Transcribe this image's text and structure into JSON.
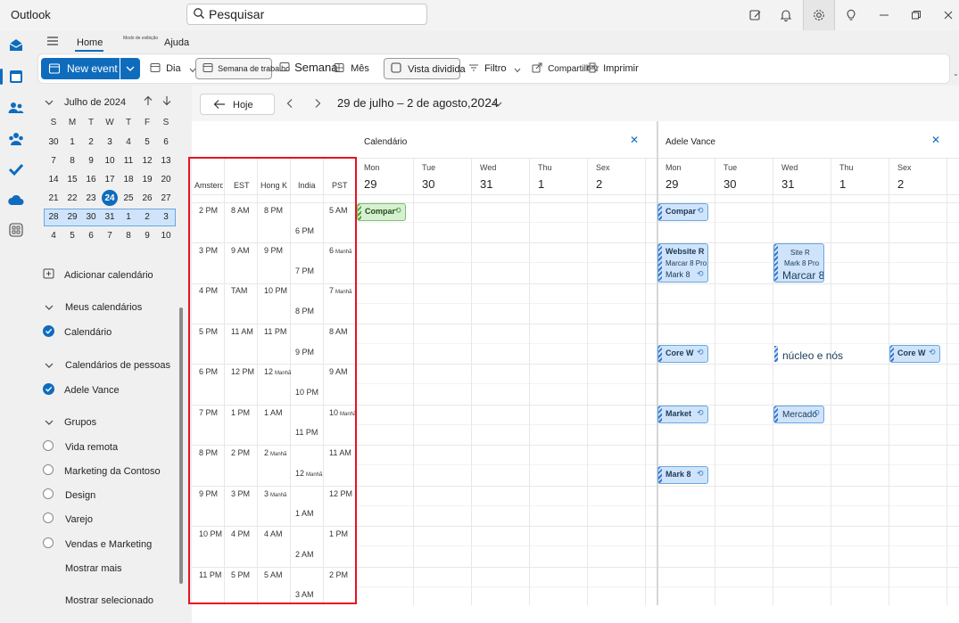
{
  "app": {
    "title": "Outlook"
  },
  "search": {
    "placeholder": "Pesquisar"
  },
  "ribbon_tabs": {
    "home": "Home",
    "edit_mode": "Modo de exibição",
    "help": "Ajuda"
  },
  "toolbar": {
    "new_event": "New event",
    "day": "Dia",
    "work_week": "Semana de trabalho",
    "week": "Semana",
    "month": "Mês",
    "split_view": "Vista dividida",
    "filter": "Filtro",
    "share": "Compartilhar",
    "print": "Imprimir"
  },
  "mini_calendar": {
    "title": "Julho de 2024",
    "weekdays": [
      "S",
      "M",
      "T",
      "W",
      "T",
      "F",
      "S"
    ],
    "weeks": [
      [
        "30",
        "1",
        "2",
        "3",
        "4",
        "5",
        "6"
      ],
      [
        "7",
        "8",
        "9",
        "10",
        "11",
        "12",
        "13"
      ],
      [
        "14",
        "15",
        "16",
        "17",
        "18",
        "19",
        "20"
      ],
      [
        "21",
        "22",
        "23",
        "24",
        "25",
        "26",
        "27"
      ],
      [
        "28",
        "29",
        "30",
        "31",
        "1",
        "2",
        "3"
      ],
      [
        "4",
        "5",
        "6",
        "7",
        "8",
        "9",
        "10"
      ]
    ],
    "today": "24"
  },
  "sidebar": {
    "add_calendar": "Adicionar calendário",
    "my_calendars": "Meus calendários",
    "calendar": "Calendário",
    "people_calendars": "Calendários de pessoas",
    "adele": "Adele Vance",
    "groups": "Grupos",
    "group_items": [
      "Vida remota",
      "Marketing da Contoso",
      "Design",
      "Varejo",
      "Vendas e Marketing"
    ],
    "show_more": "Mostrar mais",
    "show_selected": "Mostrar selecionado"
  },
  "nav": {
    "today": "Hoje",
    "range": "29 de julho – 2 de agosto,",
    "year": "2024"
  },
  "timezones": {
    "labels": [
      "Amsterdam",
      "EST",
      "Hong K",
      "India",
      "PST"
    ],
    "amsterdam": [
      "2 PM",
      "3 PM",
      "4 PM",
      "5 PM",
      "6 PM",
      "7 PM",
      "8 PM",
      "9 PM",
      "10 PM",
      "11 PM"
    ],
    "est": [
      "8 AM",
      "9 AM",
      "TAM",
      "11 AM",
      "12 PM",
      "1 PM",
      "2 PM",
      "3 PM",
      "4 PM",
      "5 PM"
    ],
    "hongkong": [
      "8 PM",
      "9 PM",
      "10 PM",
      "11 PM",
      "12",
      "1 AM",
      "2",
      "3",
      "4 AM",
      "5 AM"
    ],
    "hongkong_suffix": [
      "",
      "",
      "",
      "",
      "Manhã",
      "",
      "Manhã",
      "Manhã",
      "",
      ""
    ],
    "india": [
      "6 PM",
      "7 PM",
      "8 PM",
      "9 PM",
      "10 PM",
      "11 PM",
      "12",
      "1 AM",
      "2 AM",
      "3 AM"
    ],
    "india_suffix": [
      "",
      "",
      "",
      "",
      "",
      "",
      "Manhã",
      "",
      "",
      ""
    ],
    "pst": [
      "5 AM",
      "6",
      "7",
      "8 AM",
      "9 AM",
      "10",
      "11 AM",
      "12 PM",
      "1 PM",
      "2 PM"
    ],
    "pst_suffix": [
      "",
      "Manhã",
      "Manhã",
      "",
      "",
      "Manhã",
      "",
      "",
      "",
      ""
    ]
  },
  "calendars": {
    "left": {
      "title": "Calendário",
      "days": [
        {
          "name": "Mon",
          "num": "29"
        },
        {
          "name": "Tue",
          "num": "30"
        },
        {
          "name": "Wed",
          "num": "31"
        },
        {
          "name": "Thu",
          "num": "1"
        },
        {
          "name": "Sex",
          "num": "2"
        }
      ],
      "events": {
        "e1": "Compar"
      }
    },
    "right": {
      "title": "Adele Vance",
      "days": [
        {
          "name": "Mon",
          "num": "29"
        },
        {
          "name": "Tue",
          "num": "30"
        },
        {
          "name": "Wed",
          "num": "31"
        },
        {
          "name": "Thu",
          "num": "1"
        },
        {
          "name": "Sex",
          "num": "2"
        }
      ],
      "events": {
        "compar": "Compar",
        "website_title": "Website R",
        "website_sub1": "Marcar 8 Pro",
        "website_sub2": "Mark 8",
        "site_title": "Site R",
        "site_sub1": "Mark 8 Pro",
        "site_sub2": "Marcar 8",
        "core1": "Core W",
        "core_wed": "núcleo e nós",
        "core2": "Core W",
        "market": "Market",
        "mercado": "Mercado",
        "mark8": "Mark 8"
      }
    }
  },
  "colors": {
    "accent": "#0f6cbd",
    "highlight": "#e81123"
  }
}
